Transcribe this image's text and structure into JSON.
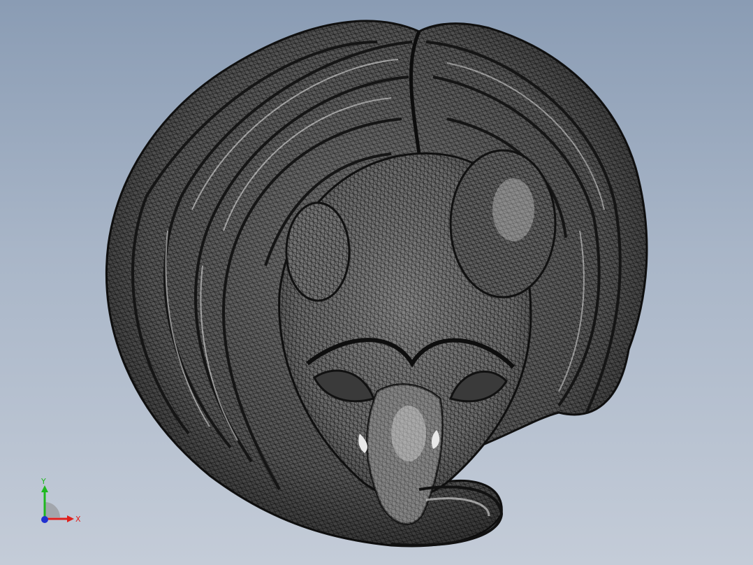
{
  "viewport": {
    "background_top": "#8a9cb4",
    "background_bottom": "#c4ccd8",
    "model_name": "",
    "display_mode": "wireframe-shaded"
  },
  "model": {
    "fill_color": "#6b6b6b",
    "edge_color": "#1a1a1a",
    "highlight_color": "#d9d9d9"
  },
  "triad": {
    "x_label": "X",
    "y_label": "Y",
    "x_color": "#e0201c",
    "y_color": "#1fb81f",
    "z_color": "#2030d0"
  }
}
